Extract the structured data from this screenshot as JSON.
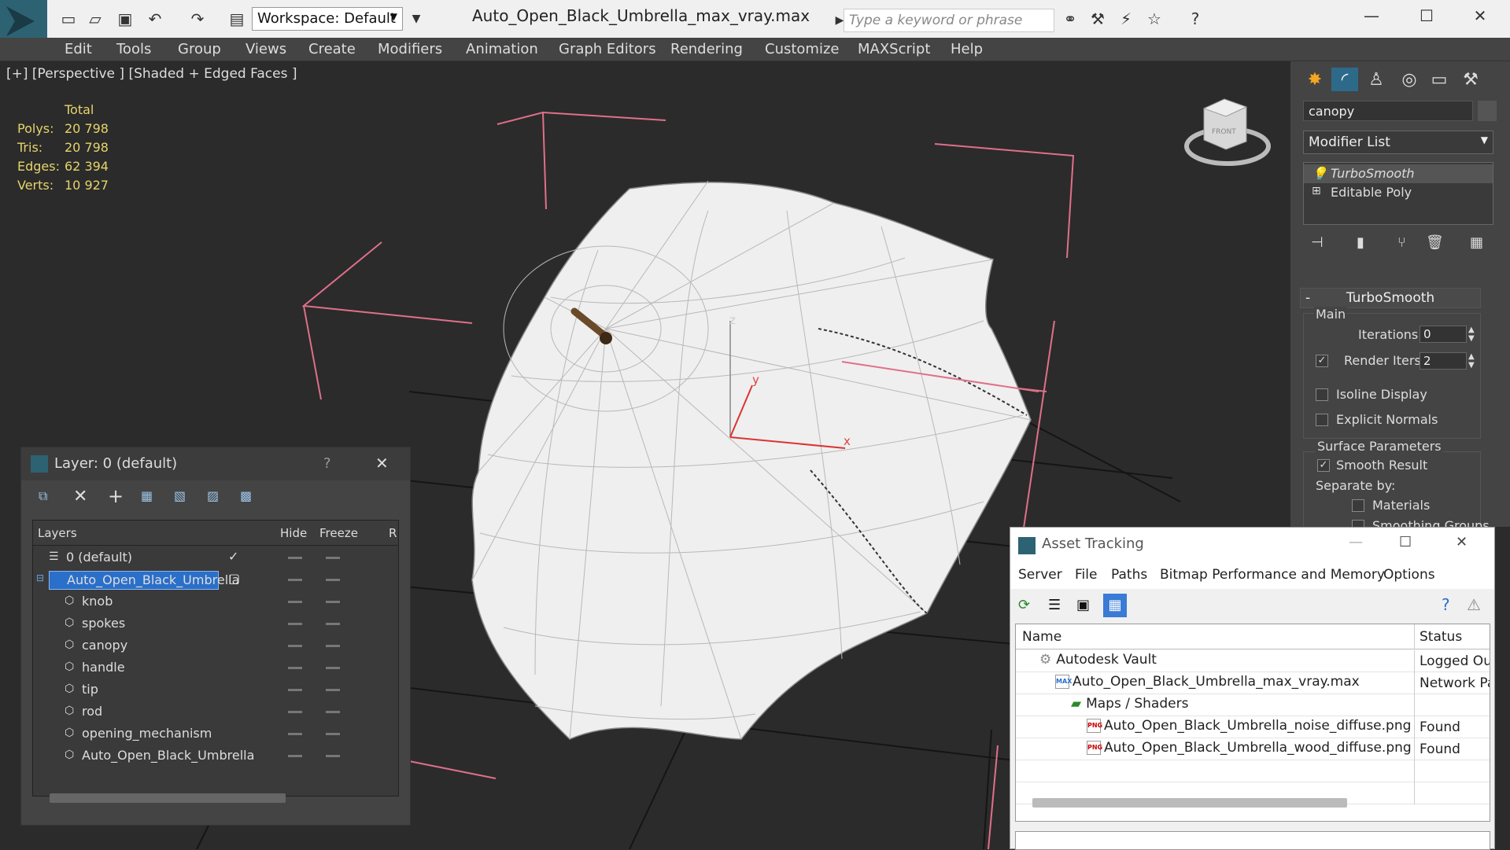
{
  "titlebar": {
    "workspace": "Workspace: Default",
    "title": "Auto_Open_Black_Umbrella_max_vray.max",
    "search_placeholder": "Type a keyword or phrase"
  },
  "menu": [
    "Edit",
    "Tools",
    "Group",
    "Views",
    "Create",
    "Modifiers",
    "Animation",
    "Graph Editors",
    "Rendering",
    "Customize",
    "MAXScript",
    "Help"
  ],
  "viewport": {
    "label": "[+] [Perspective ] [Shaded + Edged Faces ]",
    "stats": {
      "header": "Total",
      "polys_label": "Polys:",
      "polys": "20 798",
      "tris_label": "Tris:",
      "tris": "20 798",
      "edges_label": "Edges:",
      "edges": "62 394",
      "verts_label": "Verts:",
      "verts": "10 927"
    },
    "axis": {
      "z": "z",
      "y": "y",
      "x": "x"
    },
    "viewcube_label": "FRONT"
  },
  "command_panel": {
    "object_name": "canopy",
    "modifier_list": "Modifier List",
    "stack": [
      "TurboSmooth",
      "Editable Poly"
    ],
    "rollout_title": "TurboSmooth",
    "main_label": "Main",
    "iterations_label": "Iterations:",
    "iterations": "0",
    "render_iters_label": "Render Iters:",
    "render_iters": "2",
    "isoline_label": "Isoline Display",
    "explicit_label": "Explicit Normals",
    "surface_label": "Surface Parameters",
    "smooth_label": "Smooth Result",
    "separate_label": "Separate by:",
    "materials_label": "Materials",
    "smoothing_label": "Smoothing Groups"
  },
  "layer_window": {
    "title": "Layer: 0 (default)",
    "help": "?",
    "columns": {
      "layers": "Layers",
      "hide": "Hide",
      "freeze": "Freeze",
      "r": "R"
    },
    "rows": [
      {
        "name": "0 (default)"
      },
      {
        "name": "Auto_Open_Black_Umbrella"
      },
      {
        "name": "knob"
      },
      {
        "name": "spokes"
      },
      {
        "name": "canopy"
      },
      {
        "name": "handle"
      },
      {
        "name": "tip"
      },
      {
        "name": "rod"
      },
      {
        "name": "opening_mechanism"
      },
      {
        "name": "Auto_Open_Black_Umbrella"
      }
    ]
  },
  "asset_window": {
    "title": "Asset Tracking",
    "menu": [
      "Server",
      "File",
      "Paths",
      "Bitmap Performance and Memory",
      "Options"
    ],
    "columns": {
      "name": "Name",
      "status": "Status"
    },
    "rows": [
      {
        "name": "Autodesk Vault",
        "status": "Logged Out"
      },
      {
        "name": "Auto_Open_Black_Umbrella_max_vray.max",
        "status": "Network Pa"
      },
      {
        "name": "Maps / Shaders",
        "status": ""
      },
      {
        "name": "Auto_Open_Black_Umbrella_noise_diffuse.png",
        "status": "Found"
      },
      {
        "name": "Auto_Open_Black_Umbrella_wood_diffuse.png",
        "status": "Found"
      }
    ],
    "icon_max": "MAX",
    "icon_png": "PNG"
  }
}
